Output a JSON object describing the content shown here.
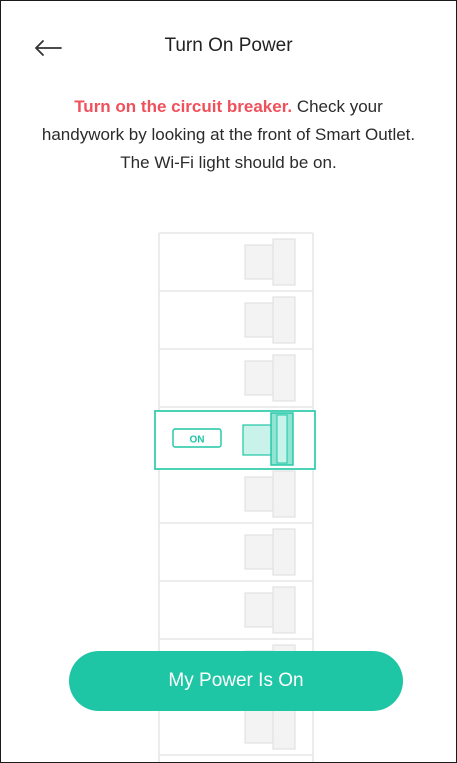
{
  "header": {
    "title": "Turn On Power",
    "back_icon": "arrow-left-icon"
  },
  "instructions": {
    "highlight": "Turn on the circuit breaker.",
    "body": " Check your handywork by looking at the front of Smart Outlet. The Wi-Fi light should be on."
  },
  "illustration": {
    "breaker_label": "ON",
    "accent_color": "#1ec6a5"
  },
  "actions": {
    "confirm_label": "My Power Is On"
  },
  "colors": {
    "highlight": "#f0505b",
    "button": "#1ec6a5"
  }
}
